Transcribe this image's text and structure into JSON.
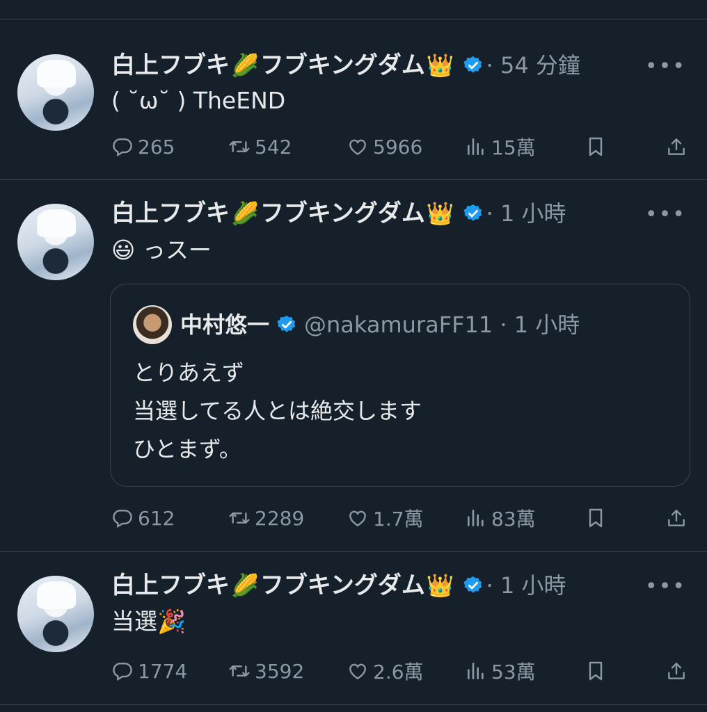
{
  "colors": {
    "background": "#15202b",
    "text": "#e7e9ea",
    "muted": "#8b98a5",
    "verified": "#1d9bf0",
    "divider": "#38444d"
  },
  "tweets": [
    {
      "author": {
        "name_part1": "白上フブキ",
        "emoji1": "🌽",
        "name_part2": "フブキングダム",
        "emoji2": "👑"
      },
      "time": "· 54 分鐘",
      "more": "•••",
      "text": "( ˘ω˘ ) TheEND",
      "stats": {
        "replies": "265",
        "retweets": "542",
        "likes": "5966",
        "views": "15萬"
      }
    },
    {
      "author": {
        "name_part1": "白上フブキ",
        "emoji1": "🌽",
        "name_part2": "フブキングダム",
        "emoji2": "👑"
      },
      "time": "· 1 小時",
      "more": "•••",
      "text_emoji": "😃",
      "text": "っスー",
      "quote": {
        "name": "中村悠一",
        "meta": "@nakamuraFF11 · 1 小時",
        "lines": [
          "とりあえず",
          "当選してる人とは絶交します",
          "ひとまず。"
        ]
      },
      "stats": {
        "replies": "612",
        "retweets": "2289",
        "likes": "1.7萬",
        "views": "83萬"
      }
    },
    {
      "author": {
        "name_part1": "白上フブキ",
        "emoji1": "🌽",
        "name_part2": "フブキングダム",
        "emoji2": "👑"
      },
      "time": "· 1 小時",
      "more": "•••",
      "text": "当選",
      "text_emoji": "🎉",
      "stats": {
        "replies": "1774",
        "retweets": "3592",
        "likes": "2.6萬",
        "views": "53萬"
      }
    }
  ]
}
